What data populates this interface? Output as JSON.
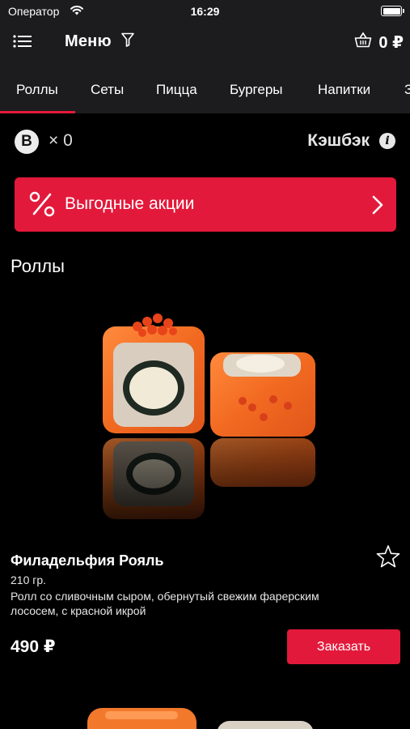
{
  "status_bar": {
    "carrier": "Оператор",
    "time": "16:29"
  },
  "nav": {
    "title": "Меню",
    "cart_total": "0 ₽"
  },
  "tabs": [
    {
      "label": "Роллы",
      "active": true
    },
    {
      "label": "Сеты"
    },
    {
      "label": "Пицца"
    },
    {
      "label": "Бургеры"
    },
    {
      "label": "Напитки"
    },
    {
      "label": "З"
    }
  ],
  "cashback": {
    "bonus_symbol": "B",
    "bonus_count": "× 0",
    "label": "Кэшбэк",
    "info_symbol": "i"
  },
  "promo": {
    "label": "Выгодные акции"
  },
  "section": {
    "title": "Роллы"
  },
  "product": {
    "name": "Филадельфия Рояль",
    "weight": "210 гр.",
    "description": "Ролл со сливочным сыром, обернутый свежим фарерским лососем, с красной икрой",
    "price": "490 ₽",
    "order_label": "Заказать"
  },
  "colors": {
    "accent": "#e3193b",
    "bar_background": "#1c1c1e",
    "page_background": "#000000"
  },
  "icons": [
    "wifi-icon",
    "battery-icon",
    "menu-list-icon",
    "filter-icon",
    "basket-icon",
    "bonus-icon",
    "info-icon",
    "percent-icon",
    "chevron-right-icon",
    "favorite-star-icon"
  ]
}
